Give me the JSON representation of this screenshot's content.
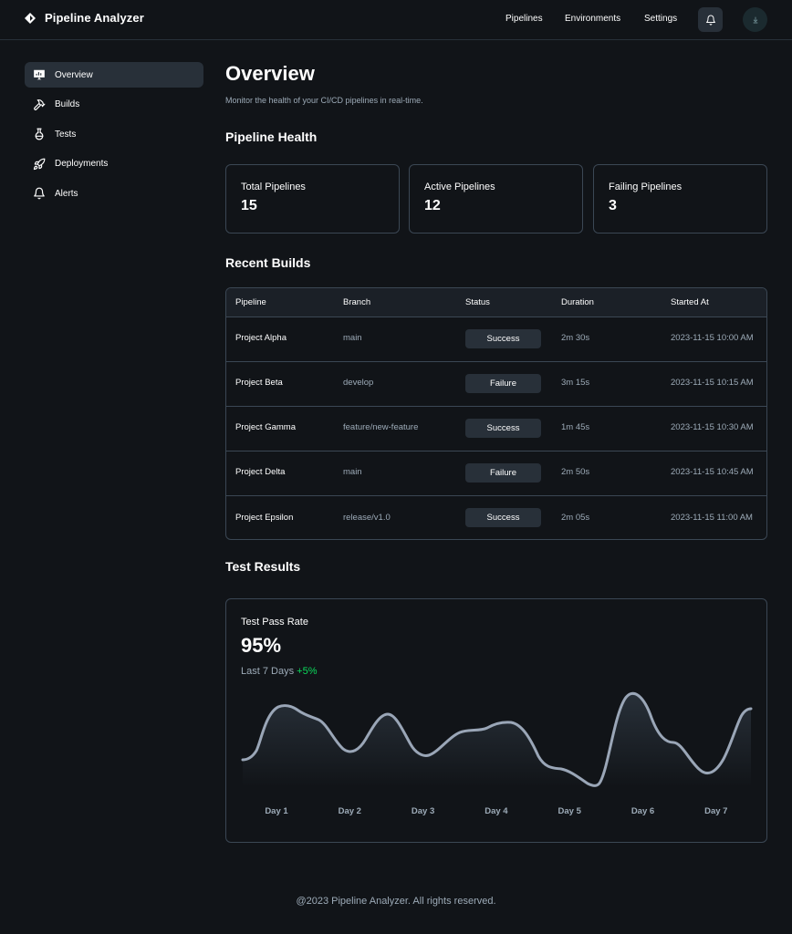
{
  "app": {
    "title": "Pipeline Analyzer"
  },
  "topnav": {
    "items": [
      "Pipelines",
      "Environments",
      "Settings"
    ]
  },
  "sidebar": {
    "items": [
      {
        "label": "Overview",
        "active": true
      },
      {
        "label": "Builds"
      },
      {
        "label": "Tests"
      },
      {
        "label": "Deployments"
      },
      {
        "label": "Alerts"
      }
    ]
  },
  "page": {
    "title": "Overview",
    "subtitle": "Monitor the health of your CI/CD pipelines in real-time."
  },
  "health": {
    "title": "Pipeline Health",
    "cards": [
      {
        "label": "Total Pipelines",
        "value": "15"
      },
      {
        "label": "Active Pipelines",
        "value": "12"
      },
      {
        "label": "Failing Pipelines",
        "value": "3"
      }
    ]
  },
  "builds": {
    "title": "Recent Builds",
    "columns": [
      "Pipeline",
      "Branch",
      "Status",
      "Duration",
      "Started At"
    ],
    "rows": [
      {
        "pipeline": "Project Alpha",
        "branch": "main",
        "status": "Success",
        "duration": "2m 30s",
        "started": "2023-11-15 10:00 AM"
      },
      {
        "pipeline": "Project Beta",
        "branch": "develop",
        "status": "Failure",
        "duration": "3m 15s",
        "started": "2023-11-15 10:15 AM"
      },
      {
        "pipeline": "Project Gamma",
        "branch": "feature/new-feature",
        "status": "Success",
        "duration": "1m 45s",
        "started": "2023-11-15 10:30 AM"
      },
      {
        "pipeline": "Project Delta",
        "branch": "main",
        "status": "Failure",
        "duration": "2m 50s",
        "started": "2023-11-15 10:45 AM"
      },
      {
        "pipeline": "Project Epsilon",
        "branch": "release/v1.0",
        "status": "Success",
        "duration": "2m 05s",
        "started": "2023-11-15 11:00 AM"
      }
    ]
  },
  "tests": {
    "title": "Test Results",
    "card_title": "Test Pass Rate",
    "value": "95%",
    "period": "Last 7 Days",
    "delta": "+5%"
  },
  "chart_data": {
    "type": "area",
    "categories": [
      "Day 1",
      "Day 2",
      "Day 3",
      "Day 4",
      "Day 5",
      "Day 6",
      "Day 7"
    ],
    "title": "",
    "xlabel": "",
    "ylabel": "",
    "grid": false,
    "legend": "none"
  },
  "colors": {
    "background": "#111418",
    "surface": "#283039",
    "border": "#3b4754",
    "muted_text": "#9dabb8",
    "positive": "#0bda5b",
    "chart_line": "#9aa6b7"
  },
  "icons": {
    "brand": "diamond-logo-icon",
    "bell": "bell-icon",
    "avatar": "avatar-icon",
    "sidebar": [
      "presentation-chart-icon",
      "hammer-icon",
      "flask-icon",
      "rocket-icon",
      "bell-icon"
    ]
  },
  "footer": {
    "text": "@2023 Pipeline Analyzer. All rights reserved."
  }
}
